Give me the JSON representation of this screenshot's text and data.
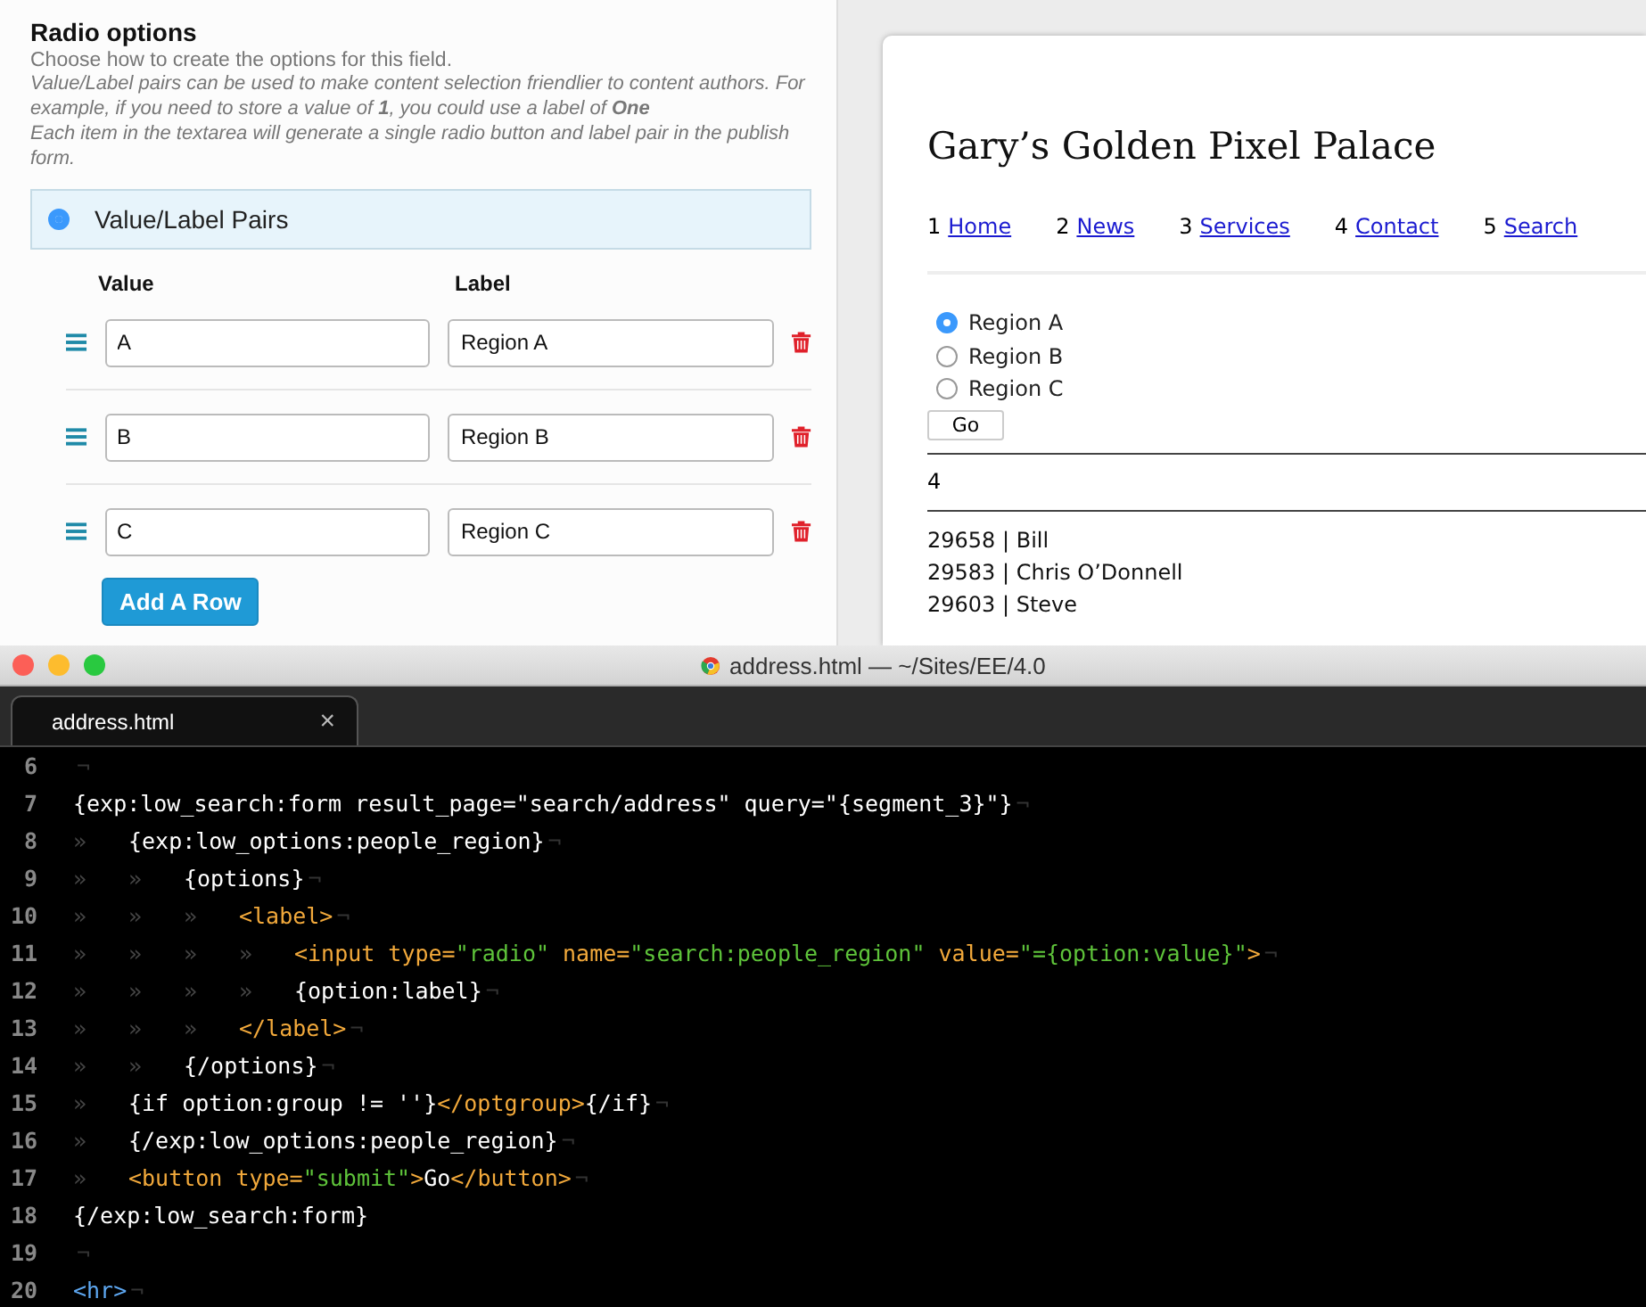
{
  "field_settings": {
    "title": "Radio options",
    "hint": "Choose how to create the options for this field.",
    "note": "Value/Label pairs can be used to make content selection friendlier to content authors. For example, if you need to store a value of **1**, you could use a label of **One**",
    "note_2": "Each item in the textarea will generate a single radio button and label pair in the publish form.",
    "choices": [
      {
        "label": "Value/Label Pairs",
        "selected": true
      }
    ],
    "columns": [
      "Value",
      "Label"
    ],
    "rows": [
      {
        "value": "A",
        "label": "Region A"
      },
      {
        "value": "B",
        "label": "Region B"
      },
      {
        "value": "C",
        "label": "Region C"
      }
    ],
    "add_button": "Add A Row"
  },
  "preview": {
    "site_title": "Gary’s Golden Pixel Palace",
    "nav": [
      {
        "number": "1",
        "label": "Home"
      },
      {
        "number": "2",
        "label": "News"
      },
      {
        "number": "3",
        "label": "Services"
      },
      {
        "number": "4",
        "label": "Contact"
      },
      {
        "number": "5",
        "label": "Search"
      }
    ],
    "radios": [
      {
        "label": "Region A",
        "selected": true
      },
      {
        "label": "Region B",
        "selected": false
      },
      {
        "label": "Region C",
        "selected": false
      }
    ],
    "go_button": "Go",
    "count": "4",
    "results": [
      "29658 | Bill",
      "29583 | Chris O’Donnell",
      "29603 | Steve"
    ]
  },
  "editor": {
    "window_title": "address.html — ~/Sites/EE/4.0",
    "tabs": [
      {
        "label": "address.html",
        "close": "×",
        "selected": true
      }
    ],
    "lines": [
      {
        "num": "6",
        "tokens": [
          {
            "kind": "eol",
            "text": "¬"
          }
        ]
      },
      {
        "num": "7",
        "tokens": [
          {
            "kind": "text",
            "text": "{exp:low_search:form result_page=\"search/address\" query=\"{segment_3}\"}"
          },
          {
            "kind": "eol",
            "text": "¬"
          }
        ]
      },
      {
        "num": "8",
        "tokens": [
          {
            "kind": "guide",
            "text": "»"
          },
          {
            "kind": "text",
            "text": "{exp:low_options:people_region}"
          },
          {
            "kind": "eol",
            "text": "¬"
          }
        ]
      },
      {
        "num": "9",
        "tokens": [
          {
            "kind": "guide",
            "text": "»"
          },
          {
            "kind": "guide",
            "text": "»"
          },
          {
            "kind": "text",
            "text": "{options}"
          },
          {
            "kind": "eol",
            "text": "¬"
          }
        ]
      },
      {
        "num": "10",
        "tokens": [
          {
            "kind": "guide",
            "text": "»"
          },
          {
            "kind": "guide",
            "text": "»"
          },
          {
            "kind": "guide",
            "text": "»"
          },
          {
            "kind": "tag",
            "text": "<label>"
          },
          {
            "kind": "eol",
            "text": "¬"
          }
        ]
      },
      {
        "num": "11",
        "tokens": [
          {
            "kind": "guide",
            "text": "»"
          },
          {
            "kind": "guide",
            "text": "»"
          },
          {
            "kind": "guide",
            "text": "»"
          },
          {
            "kind": "guide",
            "text": "»"
          },
          {
            "kind": "tag",
            "text": "<input type="
          },
          {
            "kind": "str",
            "text": "\"radio\""
          },
          {
            "kind": "tag",
            "text": " name="
          },
          {
            "kind": "str",
            "text": "\"search:people_region\""
          },
          {
            "kind": "tag",
            "text": " value="
          },
          {
            "kind": "str",
            "text": "\"={option:value}\""
          },
          {
            "kind": "tag",
            "text": ">"
          },
          {
            "kind": "eol",
            "text": "¬"
          }
        ]
      },
      {
        "num": "12",
        "tokens": [
          {
            "kind": "guide",
            "text": "»"
          },
          {
            "kind": "guide",
            "text": "»"
          },
          {
            "kind": "guide",
            "text": "»"
          },
          {
            "kind": "guide",
            "text": "»"
          },
          {
            "kind": "text",
            "text": "{option:label}"
          },
          {
            "kind": "eol",
            "text": "¬"
          }
        ]
      },
      {
        "num": "13",
        "tokens": [
          {
            "kind": "guide",
            "text": "»"
          },
          {
            "kind": "guide",
            "text": "»"
          },
          {
            "kind": "guide",
            "text": "»"
          },
          {
            "kind": "tag",
            "text": "</label>"
          },
          {
            "kind": "eol",
            "text": "¬"
          }
        ]
      },
      {
        "num": "14",
        "tokens": [
          {
            "kind": "guide",
            "text": "»"
          },
          {
            "kind": "guide",
            "text": "»"
          },
          {
            "kind": "text",
            "text": "{/options}"
          },
          {
            "kind": "eol",
            "text": "¬"
          }
        ]
      },
      {
        "num": "15",
        "tokens": [
          {
            "kind": "guide",
            "text": "»"
          },
          {
            "kind": "text",
            "text": "{if option:group != ''}"
          },
          {
            "kind": "tag",
            "text": "</optgroup>"
          },
          {
            "kind": "text",
            "text": "{/if}"
          },
          {
            "kind": "eol",
            "text": "¬"
          }
        ]
      },
      {
        "num": "16",
        "tokens": [
          {
            "kind": "guide",
            "text": "»"
          },
          {
            "kind": "text",
            "text": "{/exp:low_options:people_region}"
          },
          {
            "kind": "eol",
            "text": "¬"
          }
        ]
      },
      {
        "num": "17",
        "tokens": [
          {
            "kind": "guide",
            "text": "»"
          },
          {
            "kind": "tag",
            "text": "<button type="
          },
          {
            "kind": "str",
            "text": "\"submit\""
          },
          {
            "kind": "tag",
            "text": ">"
          },
          {
            "kind": "text",
            "text": "Go"
          },
          {
            "kind": "tag",
            "text": "</button>"
          },
          {
            "kind": "eol",
            "text": "¬"
          }
        ]
      },
      {
        "num": "18",
        "tokens": [
          {
            "kind": "text",
            "text": "{/exp:low_search:form}"
          }
        ]
      },
      {
        "num": "19",
        "tokens": [
          {
            "kind": "eol",
            "text": "¬"
          }
        ]
      },
      {
        "num": "20",
        "tokens": [
          {
            "kind": "html",
            "text": "<hr>"
          },
          {
            "kind": "eol",
            "text": "¬"
          }
        ]
      }
    ]
  }
}
